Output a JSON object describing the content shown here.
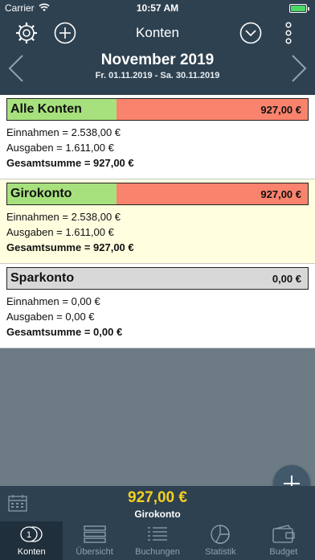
{
  "status": {
    "carrier": "Carrier",
    "time": "10:57 AM"
  },
  "nav": {
    "title": "Konten"
  },
  "period": {
    "month": "November 2019",
    "range": "Fr. 01.11.2019 - Sa. 30.11.2019"
  },
  "accounts": [
    {
      "name": "Alle Konten",
      "amount": "927,00 €",
      "income": "Einnahmen = 2.538,00 €",
      "expenses": "Ausgaben = 1.611,00 €",
      "total": "Gesamtsumme = 927,00 €"
    },
    {
      "name": "Girokonto",
      "amount": "927,00 €",
      "income": "Einnahmen = 2.538,00 €",
      "expenses": "Ausgaben = 1.611,00 €",
      "total": "Gesamtsumme = 927,00 €"
    },
    {
      "name": "Sparkonto",
      "amount": "0,00 €",
      "income": "Einnahmen = 0,00 €",
      "expenses": "Ausgaben = 0,00 €",
      "total": "Gesamtsumme = 0,00 €"
    }
  ],
  "footer": {
    "amount": "927,00 €",
    "account": "Girokonto"
  },
  "tabs": [
    {
      "label": "Konten",
      "icon": "coins-icon"
    },
    {
      "label": "Übersicht",
      "icon": "overview-icon"
    },
    {
      "label": "Buchungen",
      "icon": "list-icon"
    },
    {
      "label": "Statistik",
      "icon": "chart-icon"
    },
    {
      "label": "Budget",
      "icon": "wallet-icon"
    }
  ],
  "colors": {
    "bar": "#2e4150",
    "income": "#a7e17e",
    "expense": "#f9836d",
    "highlight": "#ffffe0",
    "total": "#f5d020"
  }
}
